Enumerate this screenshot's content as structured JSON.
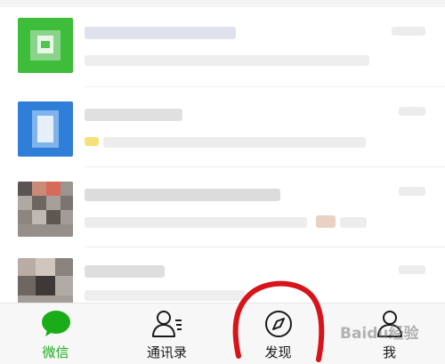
{
  "colors": {
    "accent": "#1aad19",
    "annotation": "#d8141b",
    "text": "#1a1a1a",
    "tabbar_bg": "#f7f7f7"
  },
  "tabs": [
    {
      "label": "微信",
      "icon": "chat-bubble-icon",
      "active": true
    },
    {
      "label": "通讯录",
      "icon": "contacts-icon",
      "active": false
    },
    {
      "label": "发现",
      "icon": "compass-icon",
      "active": false
    },
    {
      "label": "我",
      "icon": "person-icon",
      "active": false
    }
  ],
  "watermark": {
    "text": "Baidu经验"
  }
}
